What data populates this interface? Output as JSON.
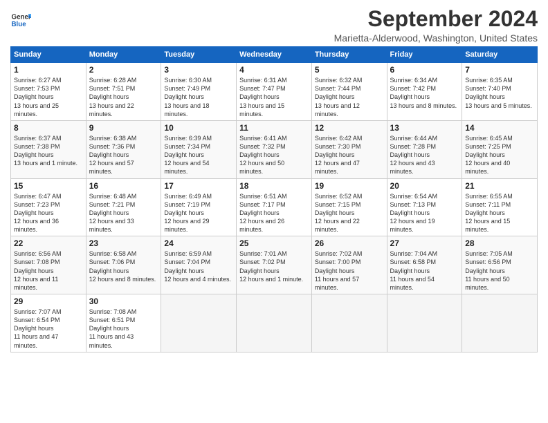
{
  "header": {
    "logo_line1": "General",
    "logo_line2": "Blue",
    "month_title": "September 2024",
    "location": "Marietta-Alderwood, Washington, United States"
  },
  "days_of_week": [
    "Sunday",
    "Monday",
    "Tuesday",
    "Wednesday",
    "Thursday",
    "Friday",
    "Saturday"
  ],
  "weeks": [
    [
      {
        "day": "1",
        "sunrise": "6:27 AM",
        "sunset": "7:53 PM",
        "daylight": "13 hours and 25 minutes."
      },
      {
        "day": "2",
        "sunrise": "6:28 AM",
        "sunset": "7:51 PM",
        "daylight": "13 hours and 22 minutes."
      },
      {
        "day": "3",
        "sunrise": "6:30 AM",
        "sunset": "7:49 PM",
        "daylight": "13 hours and 18 minutes."
      },
      {
        "day": "4",
        "sunrise": "6:31 AM",
        "sunset": "7:47 PM",
        "daylight": "13 hours and 15 minutes."
      },
      {
        "day": "5",
        "sunrise": "6:32 AM",
        "sunset": "7:44 PM",
        "daylight": "13 hours and 12 minutes."
      },
      {
        "day": "6",
        "sunrise": "6:34 AM",
        "sunset": "7:42 PM",
        "daylight": "13 hours and 8 minutes."
      },
      {
        "day": "7",
        "sunrise": "6:35 AM",
        "sunset": "7:40 PM",
        "daylight": "13 hours and 5 minutes."
      }
    ],
    [
      {
        "day": "8",
        "sunrise": "6:37 AM",
        "sunset": "7:38 PM",
        "daylight": "13 hours and 1 minute."
      },
      {
        "day": "9",
        "sunrise": "6:38 AM",
        "sunset": "7:36 PM",
        "daylight": "12 hours and 57 minutes."
      },
      {
        "day": "10",
        "sunrise": "6:39 AM",
        "sunset": "7:34 PM",
        "daylight": "12 hours and 54 minutes."
      },
      {
        "day": "11",
        "sunrise": "6:41 AM",
        "sunset": "7:32 PM",
        "daylight": "12 hours and 50 minutes."
      },
      {
        "day": "12",
        "sunrise": "6:42 AM",
        "sunset": "7:30 PM",
        "daylight": "12 hours and 47 minutes."
      },
      {
        "day": "13",
        "sunrise": "6:44 AM",
        "sunset": "7:28 PM",
        "daylight": "12 hours and 43 minutes."
      },
      {
        "day": "14",
        "sunrise": "6:45 AM",
        "sunset": "7:25 PM",
        "daylight": "12 hours and 40 minutes."
      }
    ],
    [
      {
        "day": "15",
        "sunrise": "6:47 AM",
        "sunset": "7:23 PM",
        "daylight": "12 hours and 36 minutes."
      },
      {
        "day": "16",
        "sunrise": "6:48 AM",
        "sunset": "7:21 PM",
        "daylight": "12 hours and 33 minutes."
      },
      {
        "day": "17",
        "sunrise": "6:49 AM",
        "sunset": "7:19 PM",
        "daylight": "12 hours and 29 minutes."
      },
      {
        "day": "18",
        "sunrise": "6:51 AM",
        "sunset": "7:17 PM",
        "daylight": "12 hours and 26 minutes."
      },
      {
        "day": "19",
        "sunrise": "6:52 AM",
        "sunset": "7:15 PM",
        "daylight": "12 hours and 22 minutes."
      },
      {
        "day": "20",
        "sunrise": "6:54 AM",
        "sunset": "7:13 PM",
        "daylight": "12 hours and 19 minutes."
      },
      {
        "day": "21",
        "sunrise": "6:55 AM",
        "sunset": "7:11 PM",
        "daylight": "12 hours and 15 minutes."
      }
    ],
    [
      {
        "day": "22",
        "sunrise": "6:56 AM",
        "sunset": "7:08 PM",
        "daylight": "12 hours and 11 minutes."
      },
      {
        "day": "23",
        "sunrise": "6:58 AM",
        "sunset": "7:06 PM",
        "daylight": "12 hours and 8 minutes."
      },
      {
        "day": "24",
        "sunrise": "6:59 AM",
        "sunset": "7:04 PM",
        "daylight": "12 hours and 4 minutes."
      },
      {
        "day": "25",
        "sunrise": "7:01 AM",
        "sunset": "7:02 PM",
        "daylight": "12 hours and 1 minute."
      },
      {
        "day": "26",
        "sunrise": "7:02 AM",
        "sunset": "7:00 PM",
        "daylight": "11 hours and 57 minutes."
      },
      {
        "day": "27",
        "sunrise": "7:04 AM",
        "sunset": "6:58 PM",
        "daylight": "11 hours and 54 minutes."
      },
      {
        "day": "28",
        "sunrise": "7:05 AM",
        "sunset": "6:56 PM",
        "daylight": "11 hours and 50 minutes."
      }
    ],
    [
      {
        "day": "29",
        "sunrise": "7:07 AM",
        "sunset": "6:54 PM",
        "daylight": "11 hours and 47 minutes."
      },
      {
        "day": "30",
        "sunrise": "7:08 AM",
        "sunset": "6:51 PM",
        "daylight": "11 hours and 43 minutes."
      },
      null,
      null,
      null,
      null,
      null
    ]
  ]
}
